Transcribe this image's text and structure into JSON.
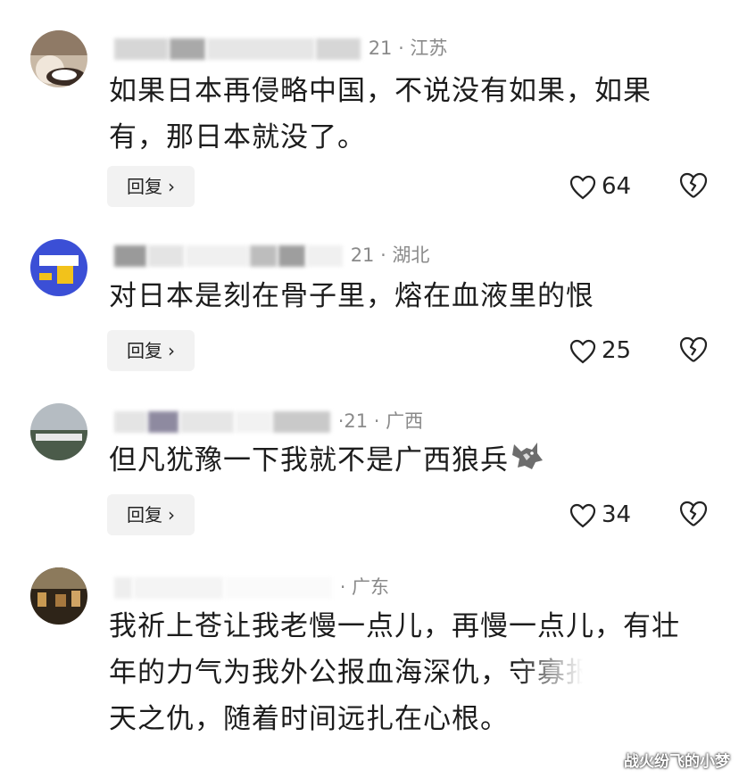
{
  "comments": [
    {
      "meta_suffix": "21 · 江苏",
      "text": "如果日本再侵略中国，不说没有如果，如果有，那日本就没了。",
      "reply_label": "回复",
      "likes": "64"
    },
    {
      "meta_suffix": "21 · 湖北",
      "text": "对日本是刻在骨子里，熔在血液里的恨",
      "reply_label": "回复",
      "likes": "25"
    },
    {
      "meta_suffix": "·21 · 广西",
      "text": "但凡犹豫一下我就不是广西狼兵",
      "reply_label": "回复",
      "likes": "34"
    },
    {
      "meta_suffix": "· 广东",
      "text": "我祈上苍让我老慢一点儿，再慢一点儿，有壮年的力气为我外公报血海深仇，守寡报不共戴天之仇，随着时间远扎在心根。"
    }
  ],
  "watermark": "战火纷飞的小梦",
  "icons": {
    "like": "heart-outline-icon",
    "dislike": "broken-heart-icon",
    "reply_chevron": "chevron-right-icon",
    "emoji": "wolf-emoji-icon"
  }
}
